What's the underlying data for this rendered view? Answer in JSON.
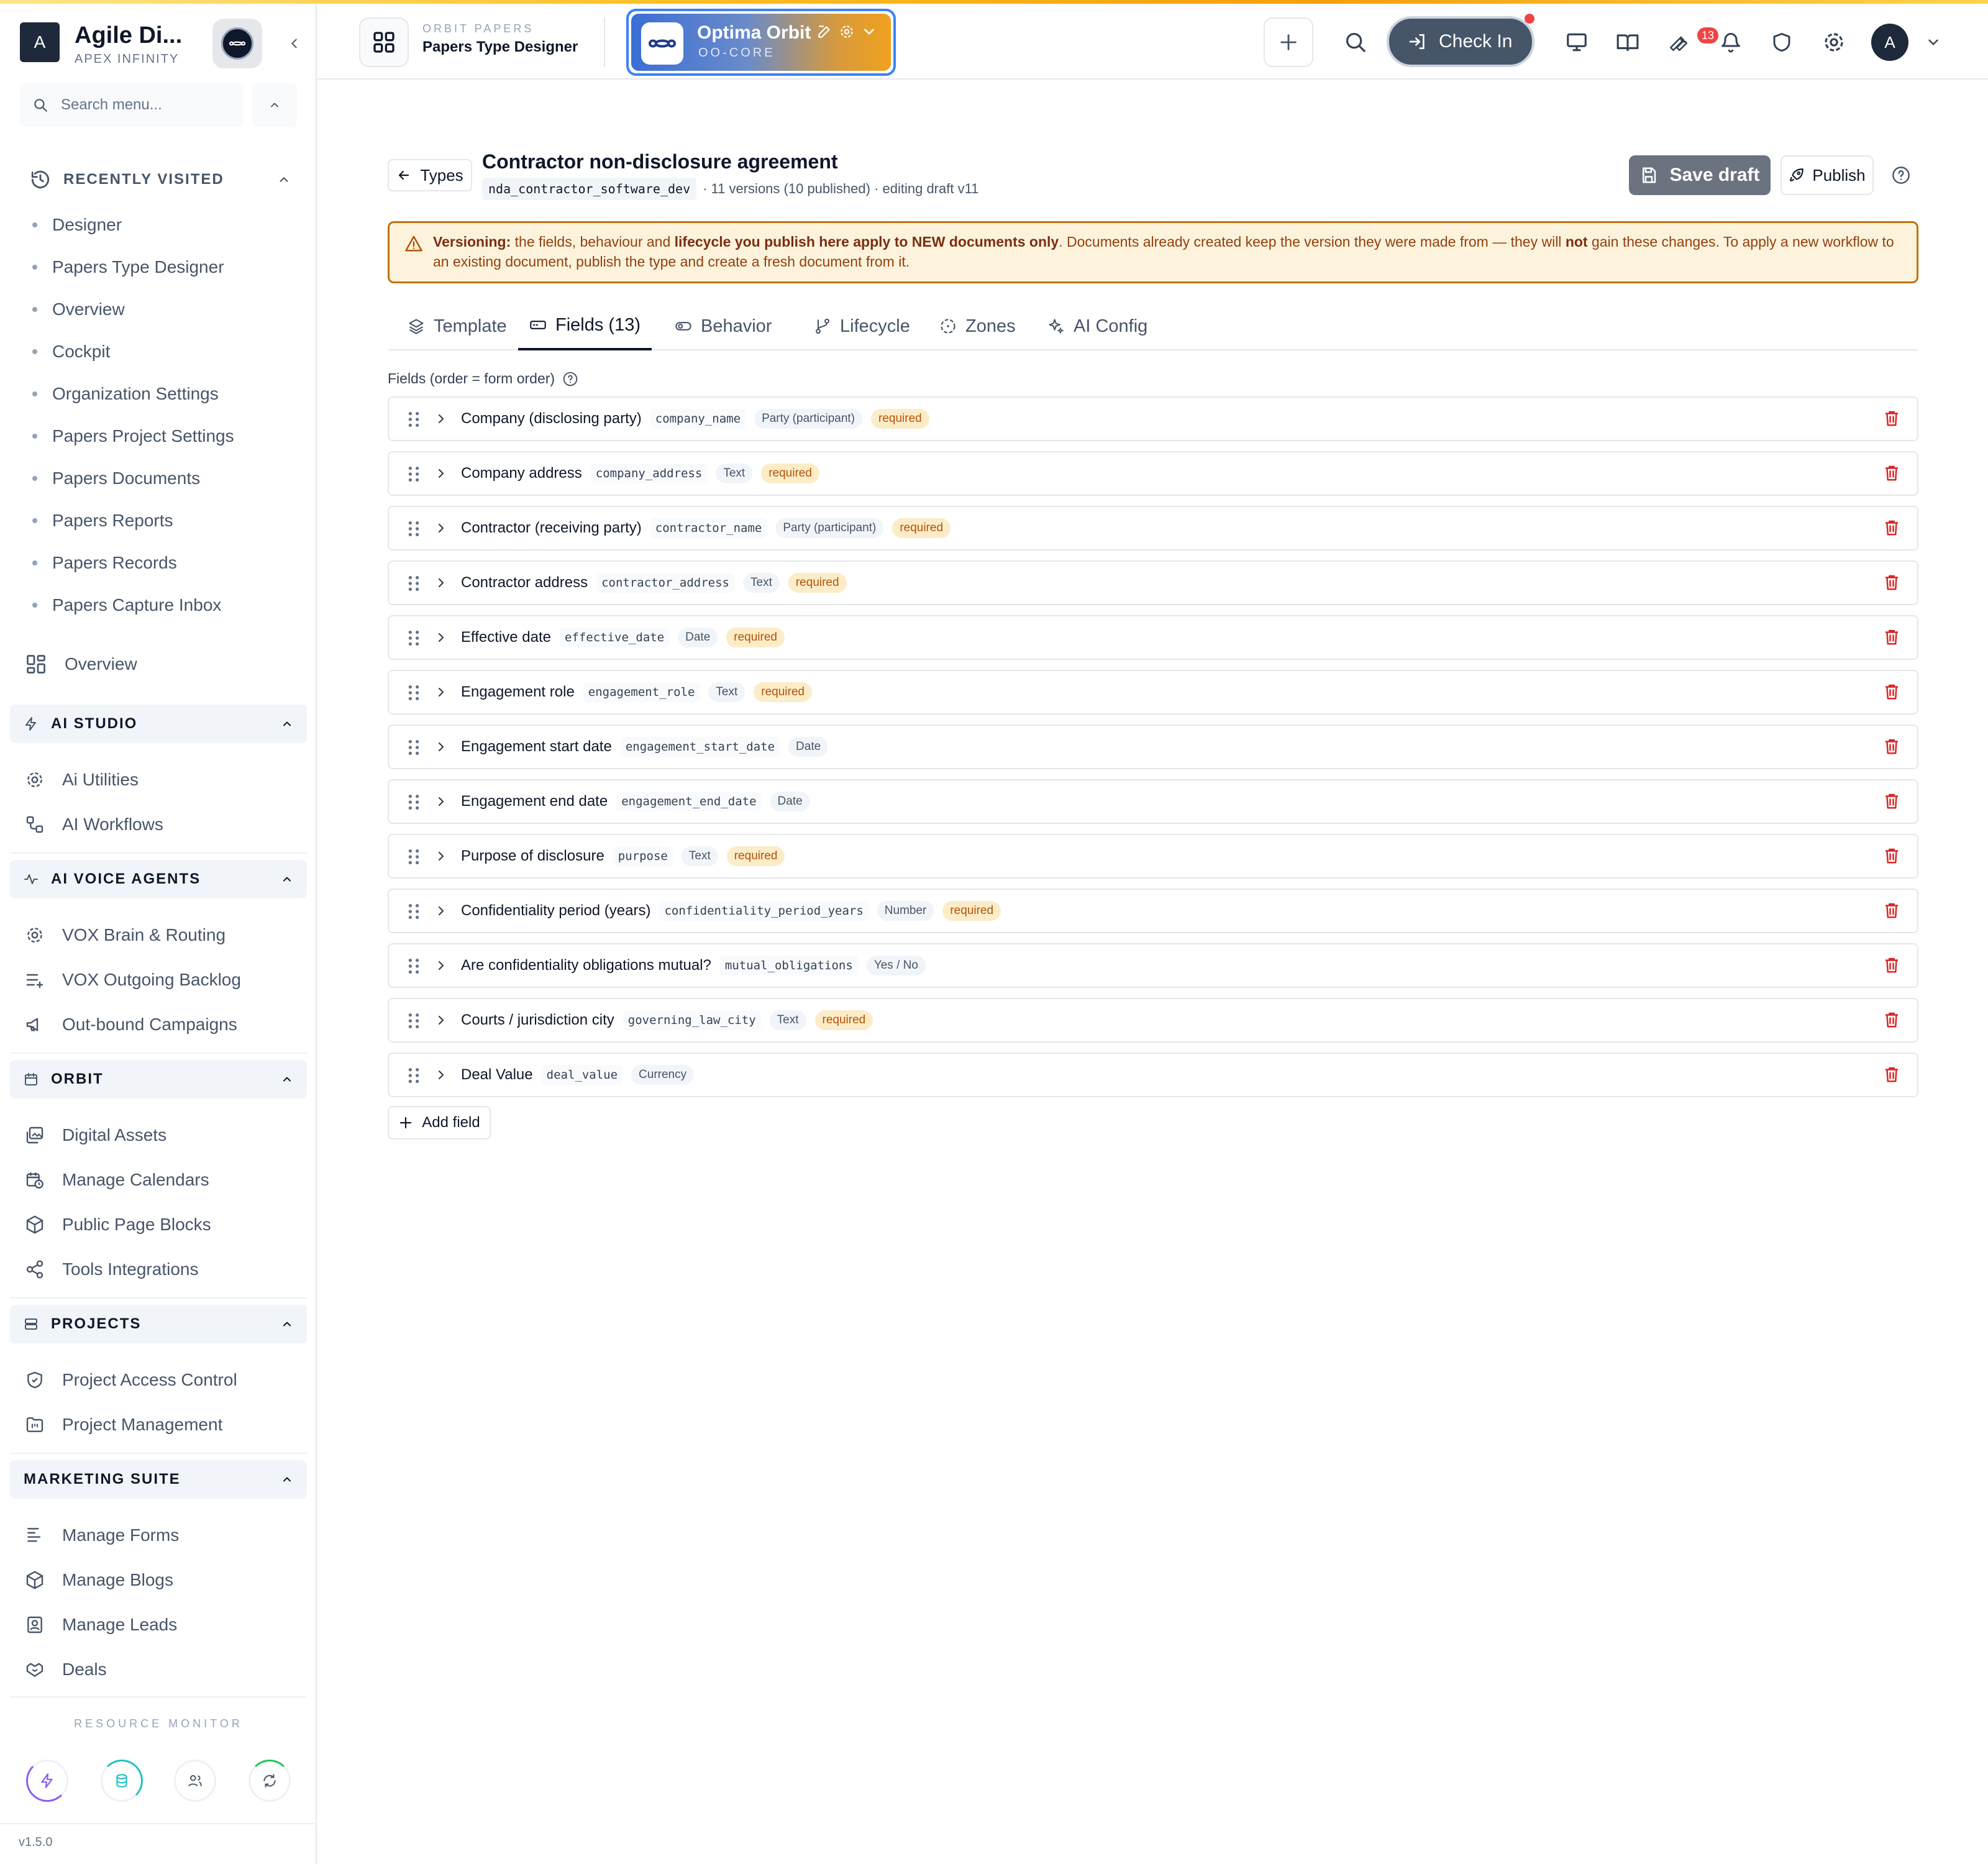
{
  "sidebar": {
    "org_initial": "A",
    "org_name": "Agile Di...",
    "org_sub": "APEX INFINITY",
    "search_placeholder": "Search menu...",
    "recent_title": "RECENTLY VISITED",
    "recent_items": [
      "Designer",
      "Papers Type Designer",
      "Overview",
      "Cockpit",
      "Organization Settings",
      "Papers Project Settings",
      "Papers Documents",
      "Papers Reports",
      "Papers Records",
      "Papers Capture Inbox"
    ],
    "overview_label": "Overview",
    "groups": {
      "ai_studio": {
        "title": "AI STUDIO",
        "items": [
          "Ai Utilities",
          "AI Workflows"
        ]
      },
      "ai_voice": {
        "title": "AI VOICE AGENTS",
        "items": [
          "VOX Brain & Routing",
          "VOX Outgoing Backlog",
          "Out-bound Campaigns"
        ]
      },
      "orbit": {
        "title": "ORBIT",
        "items": [
          "Digital Assets",
          "Manage Calendars",
          "Public Page Blocks",
          "Tools Integrations"
        ]
      },
      "projects": {
        "title": "PROJECTS",
        "items": [
          "Project Access Control",
          "Project Management"
        ]
      },
      "marketing": {
        "title": "MARKETING SUITE",
        "items": [
          "Manage Forms",
          "Manage Blogs",
          "Manage Leads",
          "Deals"
        ]
      }
    },
    "resource_monitor": "RESOURCE MONITOR",
    "version": "v1.5.0"
  },
  "topbar": {
    "crumb_sup": "ORBIT PAPERS",
    "crumb_main": "Papers Type Designer",
    "workspace_name": "Optima Orbit",
    "workspace_code": "OO-CORE",
    "checkin_label": "Check In",
    "notifications_count": "13",
    "user_initial": "A"
  },
  "document": {
    "back_label": "Types",
    "title": "Contractor non-disclosure agreement",
    "slug": "nda_contractor_software_dev",
    "meta": "· 11 versions (10 published) · editing draft v11",
    "save_label": "Save draft",
    "publish_label": "Publish"
  },
  "banner": {
    "b1": "Versioning:",
    "t1": " the fields, behaviour and ",
    "b2": "lifecycle you publish here apply to NEW documents only",
    "t2": ". Documents already created keep the version they were made from — they will ",
    "b3": "not",
    "t3": " gain these changes. To apply a new workflow to an existing document, publish the type and create a fresh document from it."
  },
  "tabs": [
    {
      "label": "Template"
    },
    {
      "label": "Fields (13)"
    },
    {
      "label": "Behavior"
    },
    {
      "label": "Lifecycle"
    },
    {
      "label": "Zones"
    },
    {
      "label": "AI Config"
    }
  ],
  "fields_label": "Fields (order = form order)",
  "fields": [
    {
      "label": "Company (disclosing party)",
      "key": "company_name",
      "type": "Party (participant)",
      "required": "required"
    },
    {
      "label": "Company address",
      "key": "company_address",
      "type": "Text",
      "required": "required"
    },
    {
      "label": "Contractor (receiving party)",
      "key": "contractor_name",
      "type": "Party (participant)",
      "required": "required"
    },
    {
      "label": "Contractor address",
      "key": "contractor_address",
      "type": "Text",
      "required": "required"
    },
    {
      "label": "Effective date",
      "key": "effective_date",
      "type": "Date",
      "required": "required"
    },
    {
      "label": "Engagement role",
      "key": "engagement_role",
      "type": "Text",
      "required": "required"
    },
    {
      "label": "Engagement start date",
      "key": "engagement_start_date",
      "type": "Date",
      "required": ""
    },
    {
      "label": "Engagement end date",
      "key": "engagement_end_date",
      "type": "Date",
      "required": ""
    },
    {
      "label": "Purpose of disclosure",
      "key": "purpose",
      "type": "Text",
      "required": "required"
    },
    {
      "label": "Confidentiality period (years)",
      "key": "confidentiality_period_years",
      "type": "Number",
      "required": "required"
    },
    {
      "label": "Are confidentiality obligations mutual?",
      "key": "mutual_obligations",
      "type": "Yes / No",
      "required": ""
    },
    {
      "label": "Courts / jurisdiction city",
      "key": "governing_law_city",
      "type": "Text",
      "required": "required"
    },
    {
      "label": "Deal Value",
      "key": "deal_value",
      "type": "Currency",
      "required": ""
    }
  ],
  "add_field_label": "Add field",
  "colors": {
    "accent": "#3b82f6",
    "danger": "#dc2626",
    "warning_border": "#c2710c",
    "warning_bg": "#fdf3dc"
  }
}
